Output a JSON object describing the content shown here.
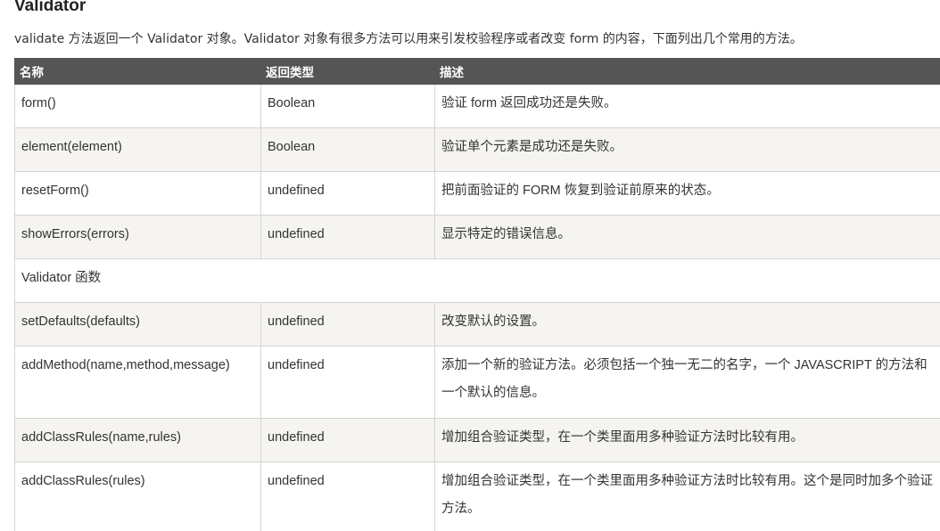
{
  "heading": "Validator",
  "intro": "validate 方法返回一个 Validator 对象。Validator 对象有很多方法可以用来引发校验程序或者改变 form 的内容，下面列出几个常用的方法。",
  "table": {
    "headers": [
      "名称",
      "返回类型",
      "描述"
    ],
    "rows": [
      {
        "name": "form()",
        "type": "Boolean",
        "desc": "验证 form 返回成功还是失败。"
      },
      {
        "name": "element(element)",
        "type": "Boolean",
        "desc": "验证单个元素是成功还是失败。"
      },
      {
        "name": "resetForm()",
        "type": "undefined",
        "desc": "把前面验证的 FORM 恢复到验证前原来的状态。"
      },
      {
        "name": "showErrors(errors)",
        "type": "undefined",
        "desc": "显示特定的错误信息。"
      }
    ],
    "section_label": "Validator 函数",
    "rows2": [
      {
        "name": "setDefaults(defaults)",
        "type": "undefined",
        "desc": "改变默认的设置。"
      },
      {
        "name": "addMethod(name,method,message)",
        "type": "undefined",
        "desc": "添加一个新的验证方法。必须包括一个独一无二的名字，一个 JAVASCRIPT 的方法和一个默认的信息。"
      },
      {
        "name": "addClassRules(name,rules)",
        "type": "undefined",
        "desc": "增加组合验证类型，在一个类里面用多种验证方法时比较有用。"
      },
      {
        "name": "addClassRules(rules)",
        "type": "undefined",
        "desc": "增加组合验证类型，在一个类里面用多种验证方法时比较有用。这个是同时加多个验证方法。"
      }
    ]
  }
}
